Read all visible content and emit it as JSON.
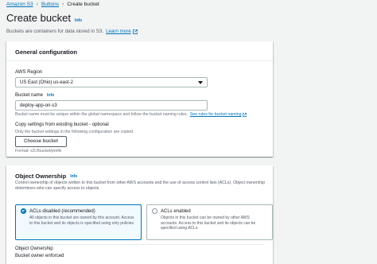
{
  "breadcrumb": {
    "items": [
      "Amazon S3",
      "Buttons",
      "Create bucket"
    ]
  },
  "header": {
    "title": "Create bucket",
    "info": "Info",
    "description": "Buckets are containers for data stored in S3.",
    "learn_more": "Learn more"
  },
  "general": {
    "title": "General configuration",
    "region_label": "AWS Region",
    "region_value": "US East (Ohio) us-east-2",
    "bucket_name_label": "Bucket name",
    "bucket_name_info": "Info",
    "bucket_name_value": "deploy-app-on-s3",
    "bucket_name_hint": "Bucket name must be unique within the global namespace and follow the bucket naming rules.",
    "bucket_name_rules_link": "See rules for bucket naming",
    "copy_label": "Copy settings from existing bucket - optional",
    "copy_hint": "Only the bucket settings in the following configuration are copied.",
    "choose_button": "Choose bucket",
    "format_hint": "Format: s3://bucket/prefix"
  },
  "ownership": {
    "title": "Object Ownership",
    "info": "Info",
    "description": "Control ownership of objects written to this bucket from other AWS accounts and the use of access control lists (ACLs). Object ownership determines who can specify access to objects.",
    "options": [
      {
        "title": "ACLs disabled (recommended)",
        "text": "All objects in this bucket are owned by this account. Access to this bucket and its objects is specified using only policies.",
        "selected": true
      },
      {
        "title": "ACLs enabled",
        "text": "Objects in this bucket can be owned by other AWS accounts. Access to this bucket and its objects can be specified using ACLs.",
        "selected": false
      }
    ],
    "result_label": "Object Ownership",
    "result_value": "Bucket owner enforced"
  },
  "colors": {
    "link": "#0073bb",
    "background": "#f2f3f3"
  }
}
